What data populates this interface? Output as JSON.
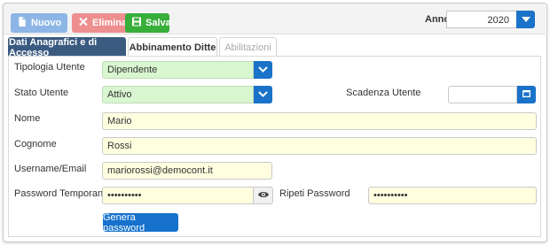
{
  "toolbar": {
    "nuovo_label": "Nuovo",
    "elimina_label": "Elimina",
    "salva_label": "Salva",
    "anno_label": "Anno",
    "anno_value": "2020"
  },
  "tabs": [
    {
      "label": "Dati Anagrafici e di Accesso",
      "active": true
    },
    {
      "label": "Abbinamento Ditte",
      "active": false
    },
    {
      "label": "Abilitazioni",
      "active": false,
      "disabled": true
    }
  ],
  "form": {
    "tipologia": {
      "label": "Tipologia Utente",
      "value": "Dipendente"
    },
    "stato": {
      "label": "Stato Utente",
      "value": "Attivo"
    },
    "scadenza": {
      "label": "Scadenza Utente",
      "value": ""
    },
    "nome": {
      "label": "Nome",
      "value": "Mario"
    },
    "cognome": {
      "label": "Cognome",
      "value": "Rossi"
    },
    "username": {
      "label": "Username/Email",
      "value": "mariorossi@democont.it"
    },
    "password": {
      "label": "Password Temporanea",
      "value": "••••••••••"
    },
    "ripeti": {
      "label": "Ripeti Password",
      "value": "••••••••••"
    },
    "genera_label": "Genera password"
  },
  "icons": {
    "nuovo": "document-icon",
    "elimina": "x-icon",
    "salva": "floppy-disk-icon",
    "dropdown": "chevron-down-icon",
    "calendar": "calendar-icon",
    "eye": "eye-icon"
  },
  "colors": {
    "primary": "#1a73c8",
    "tab_active": "#3b5a80",
    "nuovo": "#8db6e6",
    "elimina": "#ee8f8f",
    "salva": "#38ae3b",
    "select_bg": "#d8f6cf",
    "input_bg": "#ffffe0"
  }
}
